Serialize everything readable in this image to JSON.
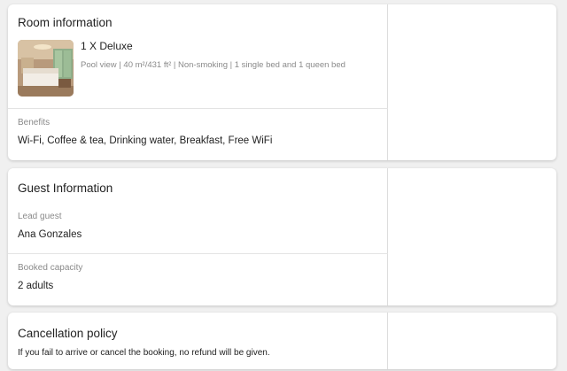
{
  "room": {
    "title": "Room information",
    "name": "1 X Deluxe",
    "description": "Pool view | 40 m²/431 ft² | Non-smoking | 1 single bed and 1 queen bed",
    "benefits_label": "Benefits",
    "benefits_value": "Wi-Fi, Coffee & tea, Drinking water, Breakfast, Free WiFi"
  },
  "guest": {
    "title": "Guest Information",
    "lead_label": "Lead guest",
    "lead_value": "Ana Gonzales",
    "capacity_label": "Booked capacity",
    "capacity_value": "2 adults"
  },
  "cancellation": {
    "title": "Cancellation policy",
    "text": "If you fail to arrive or cancel the booking, no refund will be given."
  },
  "colors": {
    "background": "#f0f0f0",
    "card": "#ffffff",
    "muted_text": "#8a8a8a"
  }
}
